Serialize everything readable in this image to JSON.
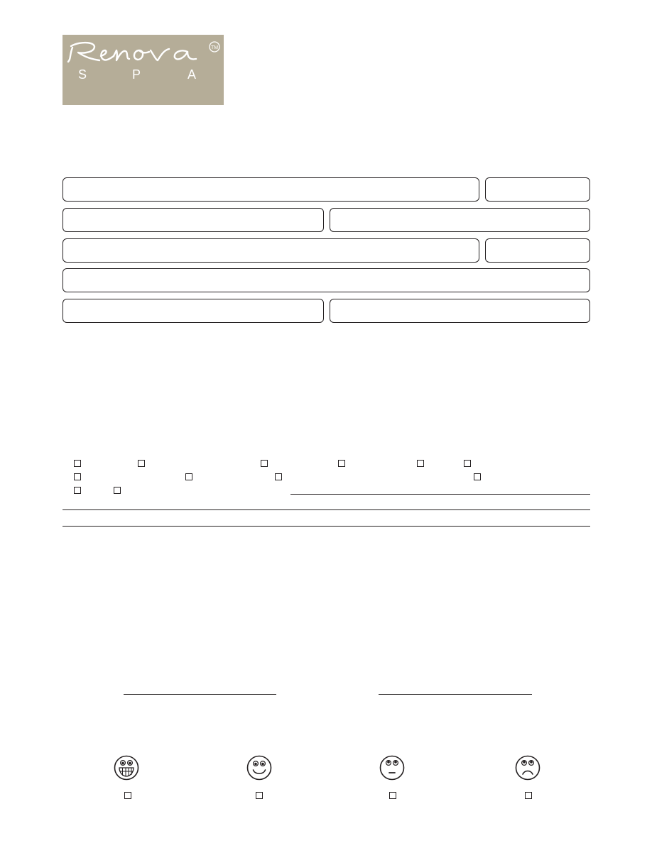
{
  "logo": {
    "brand": "Renova",
    "sub_letters": [
      "S",
      "P",
      "A"
    ],
    "trademark": "TM",
    "background": "#b5ad98"
  },
  "form": {
    "fields": [
      {
        "name": "field-row1-wide",
        "value": ""
      },
      {
        "name": "field-row1-narrow",
        "value": ""
      },
      {
        "name": "field-row2-left",
        "value": ""
      },
      {
        "name": "field-row2-right",
        "value": ""
      },
      {
        "name": "field-row3-wide",
        "value": ""
      },
      {
        "name": "field-row3-narrow",
        "value": ""
      },
      {
        "name": "field-row4-full",
        "value": ""
      },
      {
        "name": "field-row5-left",
        "value": ""
      },
      {
        "name": "field-row5-right",
        "value": ""
      }
    ],
    "checkbox_count": 15
  },
  "rating": {
    "faces": [
      "grinning-face-icon",
      "smiling-face-icon",
      "neutral-face-icon",
      "frowning-face-icon"
    ]
  },
  "colors": {
    "ink": "#231f20",
    "logo_bg": "#b5ad98",
    "logo_text": "#ffffff"
  }
}
